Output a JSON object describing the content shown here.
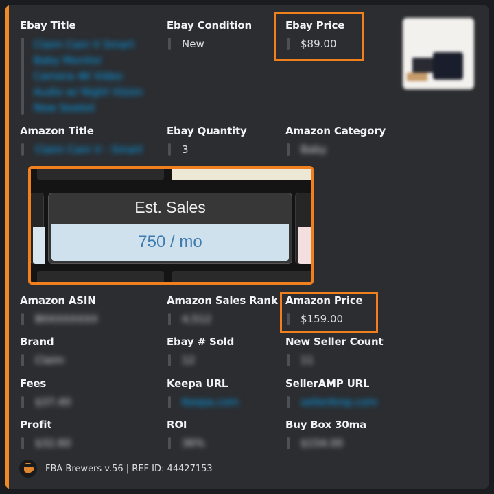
{
  "fields": {
    "ebay_title": {
      "name": "Ebay Title",
      "value_lines": [
        "Claim Cam V Smart",
        "Baby Monitor",
        "Camera 4K Video",
        "Audio w/ Night Vision",
        "New Sealed"
      ]
    },
    "ebay_condition": {
      "name": "Ebay Condition",
      "value": "New"
    },
    "ebay_price": {
      "name": "Ebay Price",
      "value": "$89.00"
    },
    "amazon_title": {
      "name": "Amazon Title",
      "value": "Claim Cam V - Smart"
    },
    "ebay_quantity": {
      "name": "Ebay Quantity",
      "value": "3"
    },
    "amazon_category": {
      "name": "Amazon Category",
      "value": "Baby"
    },
    "amazon_asin": {
      "name": "Amazon ASIN",
      "value": "B0XXXXXXX"
    },
    "amazon_sales_rank": {
      "name": "Amazon Sales Rank",
      "value": "4,512"
    },
    "amazon_price": {
      "name": "Amazon Price",
      "value": "$159.00"
    },
    "brand": {
      "name": "Brand",
      "value": "Claim"
    },
    "ebay_sold": {
      "name": "Ebay # Sold",
      "value": "12"
    },
    "new_seller_count": {
      "name": "New Seller Count",
      "value": "11"
    },
    "fees": {
      "name": "Fees",
      "value": "$37.40"
    },
    "keepa_url": {
      "name": "Keepa URL",
      "value": "Keepa.com"
    },
    "selleramp_url": {
      "name": "SellerAMP URL",
      "value": "sellerAmp.com"
    },
    "profit": {
      "name": "Profit",
      "value": "$32.60"
    },
    "roi": {
      "name": "ROI",
      "value": "36%"
    },
    "buy_box_30ma": {
      "name": "Buy Box 30ma",
      "value": "$154.00"
    }
  },
  "est_sales": {
    "label": "Est. Sales",
    "value": "750 / mo"
  },
  "footer": {
    "text": "FBA Brewers v.56 | REF ID: 44427153"
  },
  "colors": {
    "accent": "#f08a24",
    "highlight_box": "#f07f1e",
    "link": "#00a8fc",
    "embed_bg": "#2b2d31"
  }
}
